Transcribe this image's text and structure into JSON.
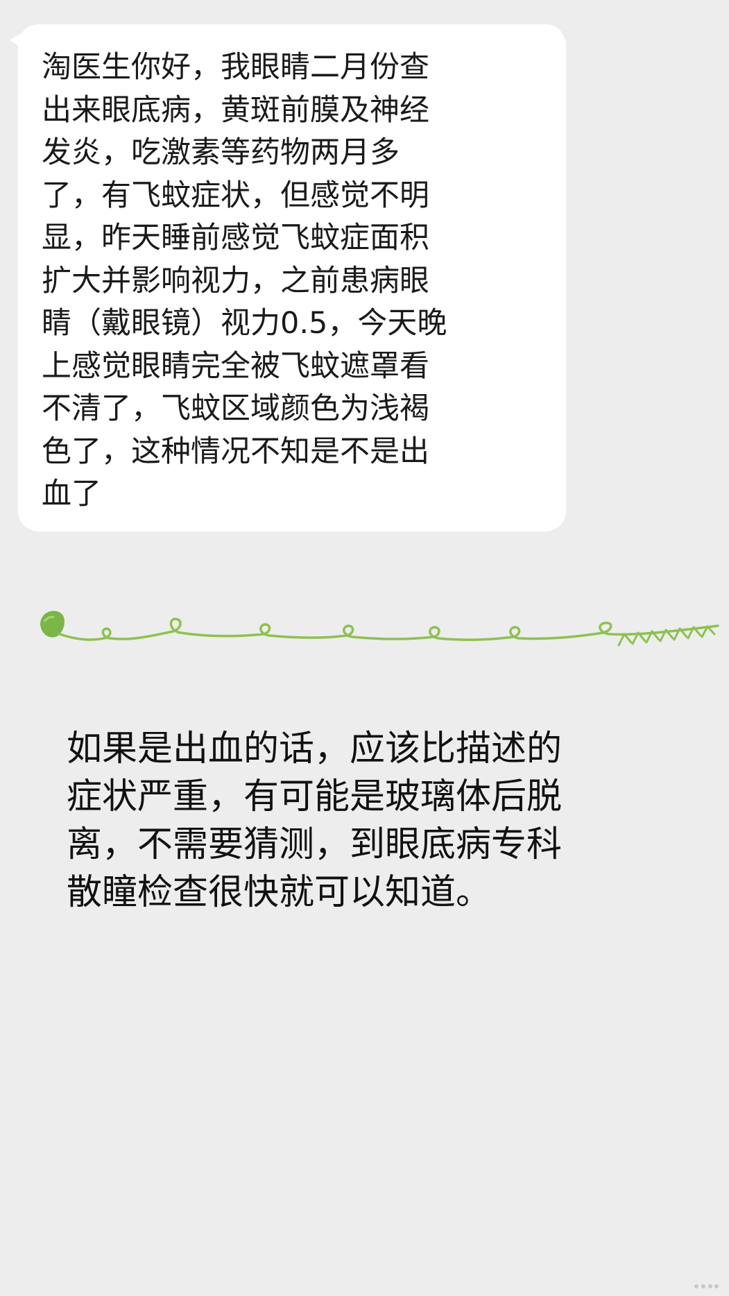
{
  "question": {
    "lines": [
      "淘医生你好，我眼睛二月份查",
      "出来眼底病，黄斑前膜及神经",
      "发炎，吃激素等药物两月多",
      "了，有飞蚊症状，但感觉不明",
      "显，昨天睡前感觉飞蚊症面积",
      "扩大并影响视力，之前患病眼",
      "睛（戴眼镜）视力0.5，今天晚",
      "上感觉眼睛完全被飞蚊遮罩看",
      "不清了，飞蚊区域颜色为浅褐",
      "色了，这种情况不知是不是出",
      "血了"
    ]
  },
  "answer": {
    "lines": [
      "如果是出血的话，应该比描述的",
      "症状严重，有可能是玻璃体后脱",
      "离，不需要猜测，到眼底病专科",
      "散瞳检查很快就可以知道。"
    ]
  },
  "colors": {
    "background": "#ededed",
    "bubble": "#ffffff",
    "vine": "#8dc150",
    "leaf": "#7ab648"
  },
  "icons": {
    "divider": "green-vine-divider-icon",
    "watermark": "dots-watermark-icon"
  }
}
